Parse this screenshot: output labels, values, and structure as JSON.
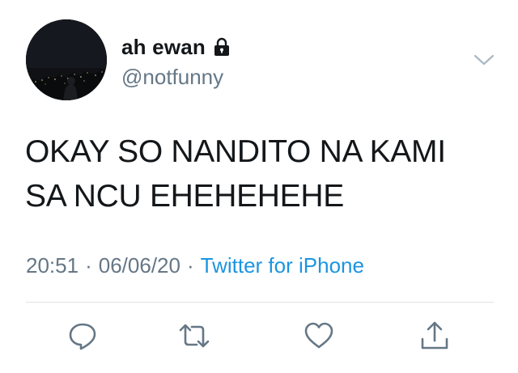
{
  "user": {
    "display_name": "ah ewan",
    "handle": "@notfunny",
    "protected_icon": "lock-icon",
    "avatar_icon": "night-city-avatar"
  },
  "tweet": {
    "text_lines": [
      "OKAY SO NANDITO NA KAMI",
      "SA NCU EHEHEHEHE"
    ],
    "time": "20:51",
    "separator": "·",
    "date": "06/06/20",
    "source": "Twitter for iPhone"
  },
  "actions": [
    {
      "name": "reply",
      "icon": "reply-icon"
    },
    {
      "name": "retweet",
      "icon": "retweet-icon"
    },
    {
      "name": "like",
      "icon": "heart-icon"
    },
    {
      "name": "share",
      "icon": "share-icon"
    }
  ],
  "menu": {
    "icon": "chevron-down-icon"
  },
  "colors": {
    "text": "#14171a",
    "secondary": "#657786",
    "link": "#1b95e0",
    "divider": "#dfe3e7"
  }
}
